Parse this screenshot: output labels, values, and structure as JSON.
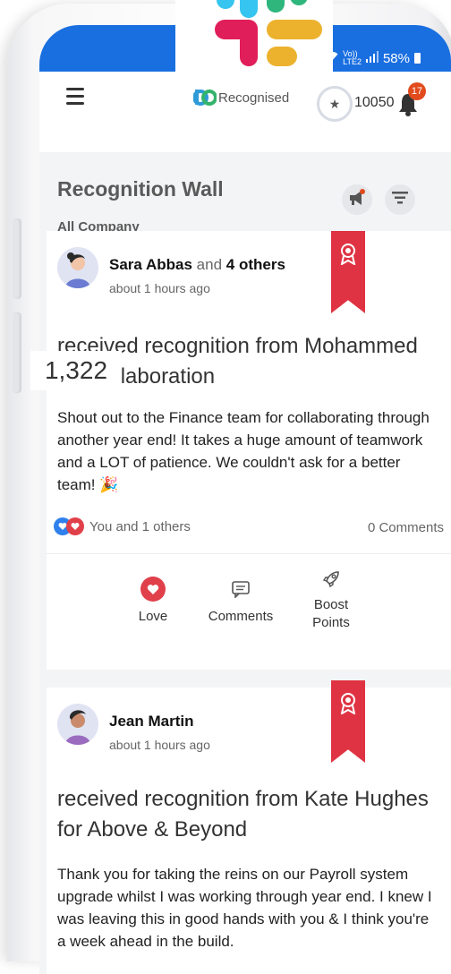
{
  "status_bar": {
    "signal_text": "Vo))",
    "lte_text": "LTE2",
    "battery": "58%"
  },
  "app_bar": {
    "brand": "Recognised",
    "points": "10050",
    "notifications": "17"
  },
  "wall": {
    "title": "Recognition Wall",
    "filter": "All Company"
  },
  "overlay_count": "1,322",
  "posts": [
    {
      "name": "Sara Abbas",
      "connector": "and",
      "others": "4 others",
      "time": "about 1 hours ago",
      "headline_1": "received recognition from Mohammed",
      "headline_2": "for Collaboration",
      "body": "Shout out to the Finance team for collaborating through another year end! It takes a huge amount of teamwork and a LOT of patience. We couldn't ask for a better team! 🎉",
      "reactions": "You and 1 others",
      "comments": "0 Comments",
      "actions": {
        "love": "Love",
        "comments": "Comments",
        "boost_1": "Boost",
        "boost_2": "Points"
      }
    },
    {
      "name": "Jean Martin",
      "time": "about 1 hours ago",
      "headline_1": "received recognition from Kate Hughes",
      "headline_2": "for Above & Beyond",
      "body": "Thank you for taking the reins on our Payroll system upgrade whilst I was working through year end. I knew I was leaving this in good hands with you & I think you're a week ahead in the build."
    }
  ],
  "colors": {
    "status_blue": "#1a6fe0",
    "ribbon_red": "#df3343",
    "love_red": "#e0404a",
    "badge_orange": "#e14b1d"
  }
}
